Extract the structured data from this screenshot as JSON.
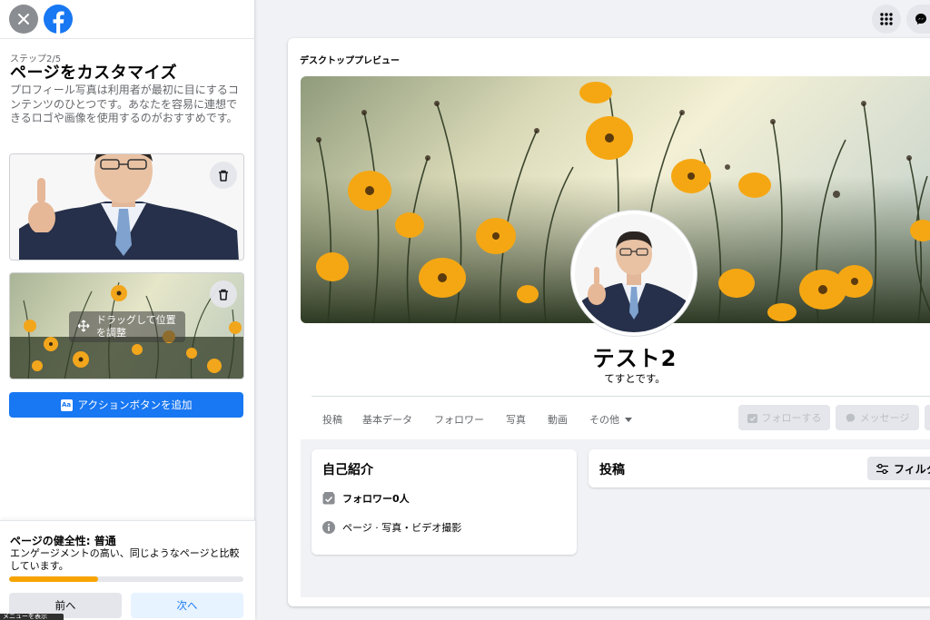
{
  "sidebar": {
    "step": "ステップ2/5",
    "title": "ページをカスタマイズ",
    "description": "プロフィール写真は利用者が最初に目にするコンテンツのひとつです。あなたを容易に連想できるロゴや画像を使用するのがおすすめです。",
    "drag_hint": "ドラッグして位置を調整",
    "action_button": "アクションボタンを追加",
    "action_badge": "Aa",
    "health": {
      "title": "ページの健全性: 普通",
      "description": "エンゲージメントの高い、同じようなページと比較しています。",
      "progress": 0.38
    },
    "prev_label": "前へ",
    "next_label": "次へ",
    "tooltip": "メニューを表示"
  },
  "topbar": {
    "icons": [
      "menu-grid-icon",
      "messenger-icon"
    ]
  },
  "preview": {
    "label": "デスクトッププレビュー",
    "page_name": "テスト2",
    "page_subtitle": "てすとです。",
    "tabs": [
      "投稿",
      "基本データ",
      "フォロワー",
      "写真",
      "動画",
      "その他"
    ],
    "follow_label": "フォローする",
    "message_label": "メッセージ",
    "intro": {
      "title": "自己紹介",
      "followers": "フォロワー0人",
      "category": "ページ · 写真・ビデオ撮影"
    },
    "posts": {
      "title": "投稿",
      "filter_label": "フィルター"
    }
  },
  "colors": {
    "brand_blue": "#1877f2",
    "health_fill": "#f7a400",
    "background": "#f0f2f5"
  }
}
